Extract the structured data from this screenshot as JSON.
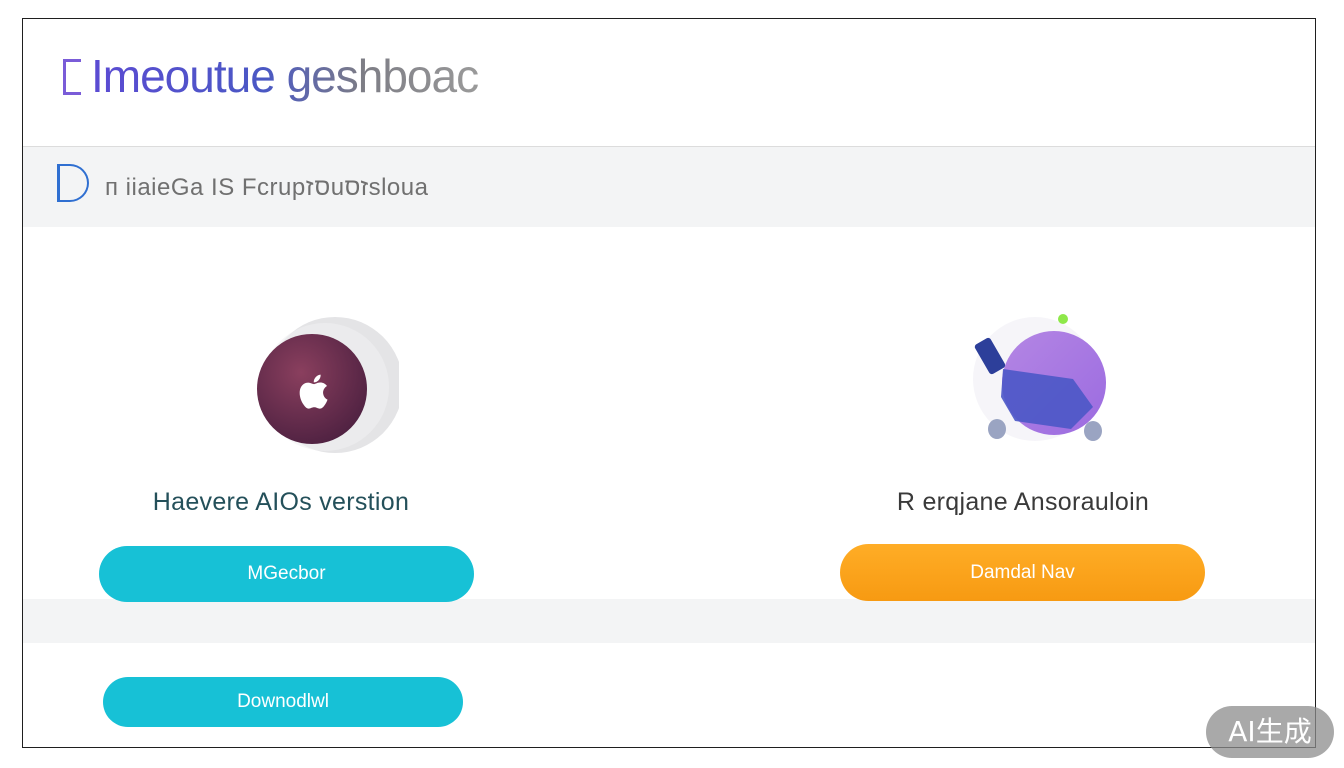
{
  "header": {
    "title": "Imeoutue geshboac"
  },
  "subheader": {
    "text": "п iiaieGa IS Fcrupסזuזסsloua"
  },
  "left_card": {
    "label": "Haevere AIOs verstion",
    "button_label": "MGecbor",
    "icon": "apple-logo-icon"
  },
  "right_card": {
    "label": "R erqjane Ansorauloin",
    "button_label": "Damdal Nav",
    "icon": "paint-brush-icon"
  },
  "bottom": {
    "button_label": "Downodlwl"
  },
  "watermark": {
    "text": "AI生成"
  },
  "colors": {
    "cyan": "#17c1d6",
    "orange": "#f79a12",
    "purple": "#a779e0",
    "plum": "#6a2f4f"
  }
}
